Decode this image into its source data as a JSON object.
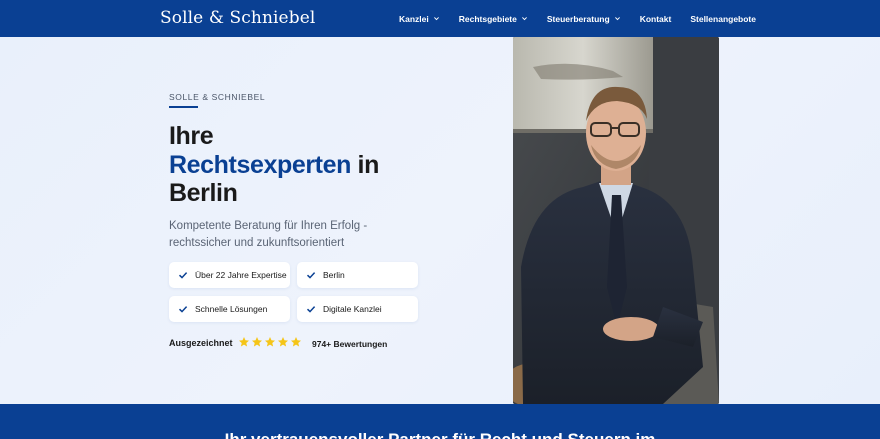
{
  "brand": {
    "name": "Solle & Schniebel"
  },
  "nav": {
    "items": [
      {
        "label": "Kanzlei",
        "dropdown": true
      },
      {
        "label": "Rechtsgebiete",
        "dropdown": true
      },
      {
        "label": "Steuerberatung",
        "dropdown": true
      },
      {
        "label": "Kontakt",
        "dropdown": false
      },
      {
        "label": "Stellenangebote",
        "dropdown": false
      }
    ]
  },
  "hero": {
    "eyebrow": "SOLLE & SCHNIEBEL",
    "headline_line1": "Ihre",
    "headline_accent": "Rechtsexperten",
    "headline_rest": " in",
    "headline_line3": "Berlin",
    "subtitle": "Kompetente Beratung für Ihren Erfolg - rechtssicher und zukunftsorientiert",
    "features": [
      {
        "label": "Über 22 Jahre Expertise",
        "icon": "check-icon"
      },
      {
        "label": "Berlin",
        "icon": "check-icon"
      },
      {
        "label": "Schnelle Lösungen",
        "icon": "check-icon"
      },
      {
        "label": "Digitale Kanzlei",
        "icon": "check-icon"
      }
    ],
    "rating_label": "Ausgezeichnet",
    "stars": 5,
    "reviews": "974+ Bewertungen",
    "photo_alt": "portrait-photo"
  },
  "band": {
    "title": "Ihr vertrauensvoller Partner für Recht und Steuern im"
  },
  "colors": {
    "primary": "#0a4093",
    "background": "#eef3fc",
    "star": "#f5c518",
    "text": "#1a1a1a"
  }
}
